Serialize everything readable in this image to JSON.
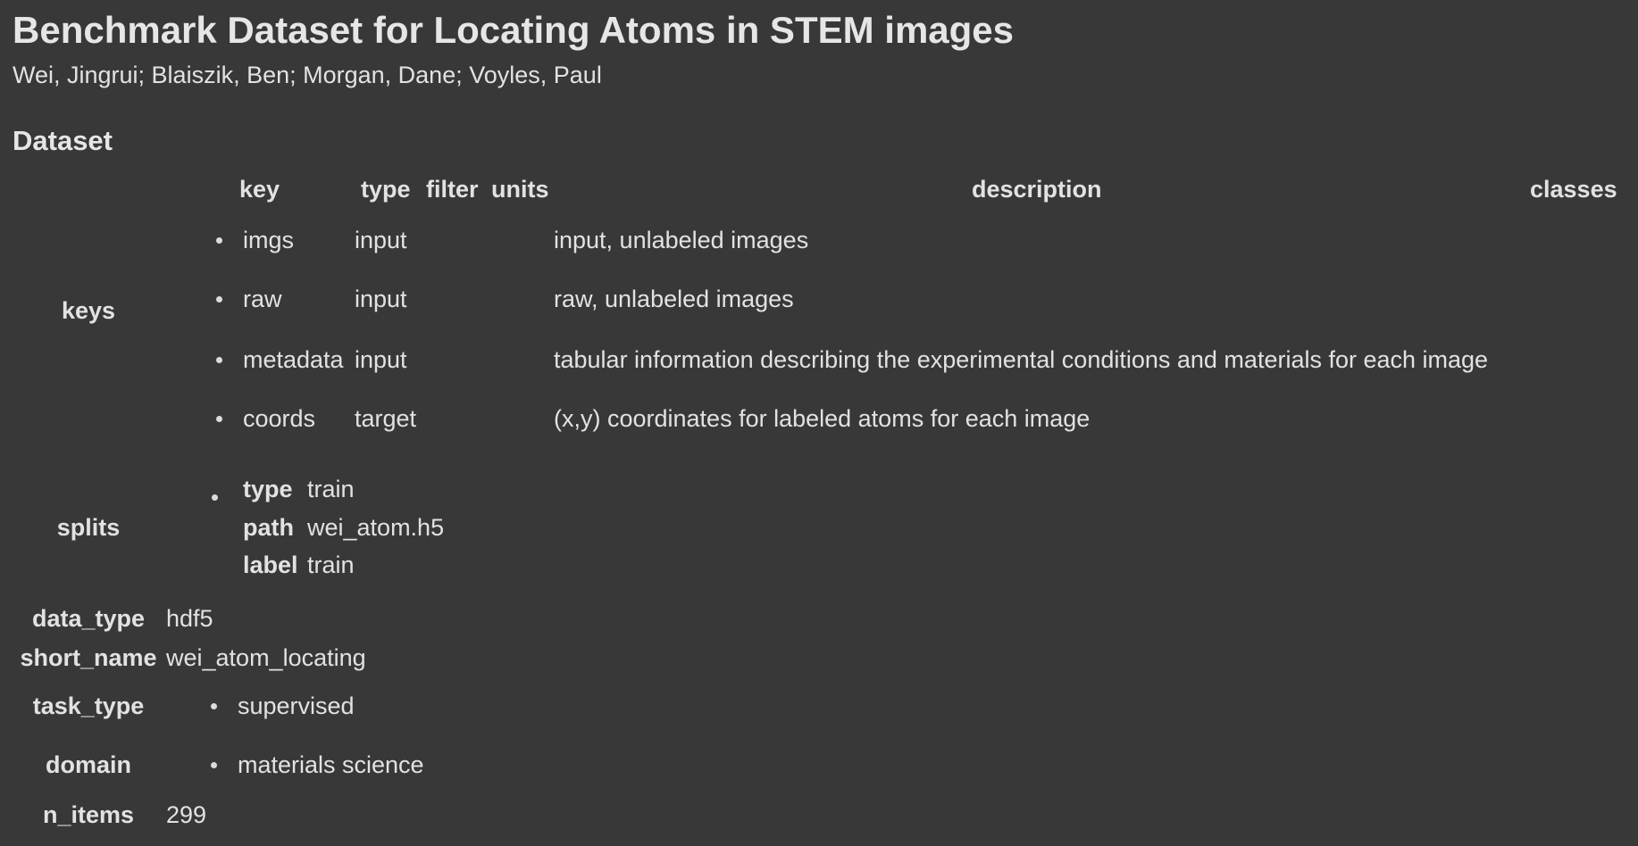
{
  "title": "Benchmark Dataset for Locating Atoms in STEM images",
  "authors": "Wei, Jingrui; Blaiszik, Ben; Morgan, Dane; Voyles, Paul",
  "section_heading": "Dataset",
  "keys": {
    "label": "keys",
    "headers": {
      "key": "key",
      "type": "type",
      "filter": "filter",
      "units": "units",
      "description": "description",
      "classes": "classes"
    },
    "rows": [
      {
        "key": "imgs",
        "type": "input",
        "filter": "",
        "units": "",
        "description": "input, unlabeled images",
        "classes": ""
      },
      {
        "key": "raw",
        "type": "input",
        "filter": "",
        "units": "",
        "description": "raw, unlabeled images",
        "classes": ""
      },
      {
        "key": "metadata",
        "type": "input",
        "filter": "",
        "units": "",
        "description": "tabular information describing the experimental conditions and materials for each image",
        "classes": ""
      },
      {
        "key": "coords",
        "type": "target",
        "filter": "",
        "units": "",
        "description": "(x,y) coordinates for labeled atoms for each image",
        "classes": ""
      }
    ]
  },
  "splits": {
    "label": "splits",
    "items": [
      {
        "type_label": "type",
        "type": "train",
        "path_label": "path",
        "path": "wei_atom.h5",
        "label_label": "label",
        "label": "train"
      }
    ]
  },
  "data_type": {
    "label": "data_type",
    "value": "hdf5"
  },
  "short_name": {
    "label": "short_name",
    "value": "wei_atom_locating"
  },
  "task_type": {
    "label": "task_type",
    "items": [
      "supervised"
    ]
  },
  "domain": {
    "label": "domain",
    "items": [
      "materials science"
    ]
  },
  "n_items": {
    "label": "n_items",
    "value": "299"
  }
}
